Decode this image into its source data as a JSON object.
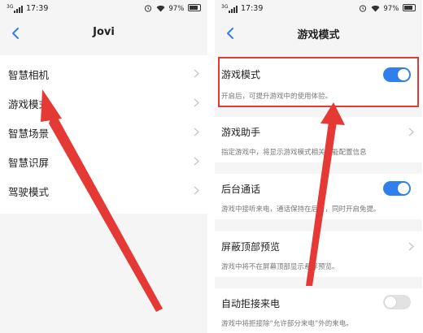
{
  "status_bar": {
    "network": "3G",
    "time": "17:39",
    "battery": "97%"
  },
  "left": {
    "title": "Jovi",
    "items": [
      {
        "label": "智慧相机"
      },
      {
        "label": "游戏模式"
      },
      {
        "label": "智慧场景"
      },
      {
        "label": "智慧识屏"
      },
      {
        "label": "驾驶模式"
      }
    ]
  },
  "right": {
    "title": "游戏模式",
    "settings": [
      {
        "title": "游戏模式",
        "desc": "开启后，可提升游戏中的使用体验。",
        "control": "toggle",
        "on": true
      },
      {
        "title": "游戏助手",
        "desc": "指定游戏中，将显示游戏模式相关功能配置信息",
        "control": "chevron"
      },
      {
        "title": "后台通话",
        "desc": "游戏中接听来电，通话保持在后台，同时开启免提。",
        "control": "toggle",
        "on": true
      },
      {
        "title": "屏蔽顶部预览",
        "desc": "游戏中将不在屏幕顶部显示悬浮预览。",
        "control": "chevron"
      },
      {
        "title": "自动拒接来电",
        "desc": "游戏中将拒接除“允许部分来电”外的来电。",
        "control": "toggle",
        "on": false
      }
    ]
  },
  "colors": {
    "accent": "#2f80ed",
    "annotation": "#e53935"
  }
}
